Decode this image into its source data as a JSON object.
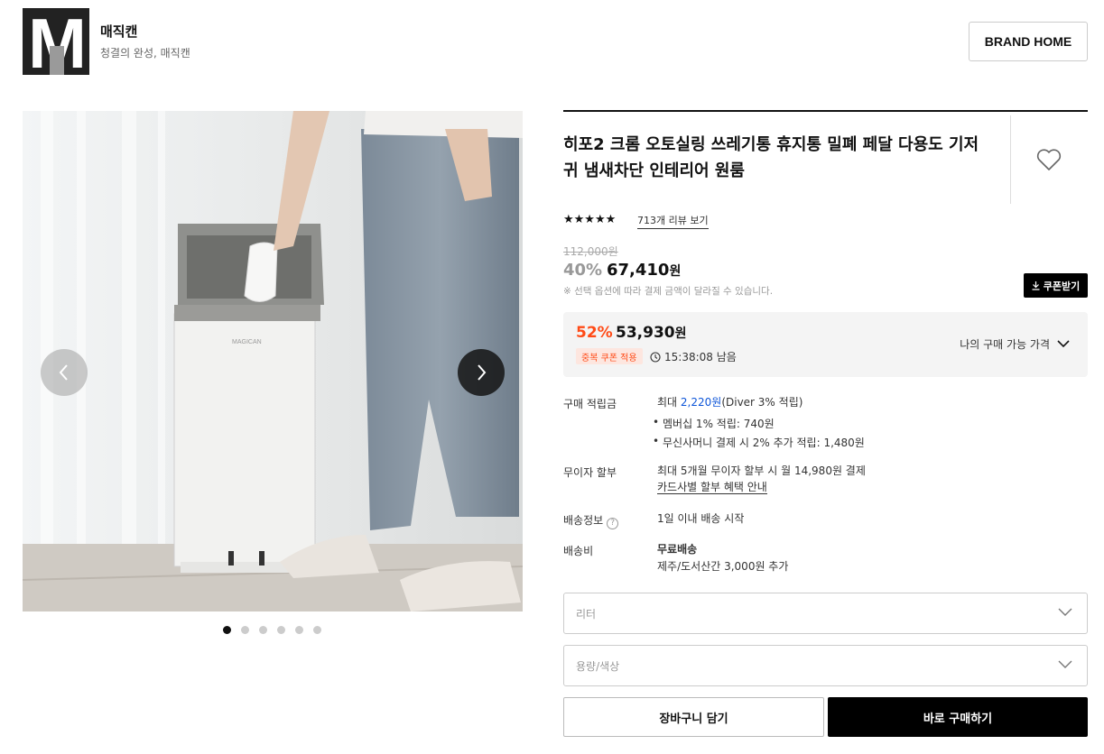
{
  "brand": {
    "logo_letter": "M",
    "name": "매직캔",
    "slogan": "청결의 완성, 매직캔",
    "home_button": "BRAND HOME"
  },
  "gallery": {
    "image_brand_text": "MAGICAN",
    "slide_count": 6,
    "active_slide": 1
  },
  "product": {
    "title": "히포2 크롬 오토실링 쓰레기통 휴지통 밀폐 페달 다용도 기저귀 냄새차단 인테리어 원룸",
    "rating_stars": "★★★★★",
    "review_link": "713개 리뷰 보기",
    "original_price": "112,000원",
    "discount_rate": "40%",
    "price": "67,410",
    "price_unit": "원",
    "notice": "※ 선택 옵션에 따라 결제 금액이 달라질 수 있습니다.",
    "coupon_button": "쿠폰받기"
  },
  "my_price": {
    "rate": "52%",
    "price": "53,930",
    "unit": "원",
    "badge": "중복 쿠폰 적용",
    "timer": "15:38:08 남음",
    "label": "나의 구매 가능 가격"
  },
  "info": {
    "points_label": "구매 적립금",
    "points_prefix": "최대 ",
    "points_amount": "2,220원",
    "points_suffix": "(Diver 3% 적립)",
    "points_bullet_1": "멤버십 1% 적립: 740원",
    "points_bullet_2": "무신사머니 결제 시 2% 추가 적립: 1,480원",
    "installment_label": "무이자 할부",
    "installment_value": "최대 5개월 무이자 할부 시 월 14,980원 결제",
    "installment_link": "카드사별 할부 혜택 안내",
    "shipping_label": "배송정보",
    "shipping_help": "?",
    "shipping_value": "1일 이내 배송 시작",
    "fee_label": "배송비",
    "fee_value": "무료배송",
    "fee_extra": "제주/도서산간 3,000원 추가"
  },
  "options": {
    "select_1_placeholder": "리터",
    "select_2_placeholder": "용량/색상"
  },
  "actions": {
    "cart": "장바구니 담기",
    "buy": "바로 구매하기"
  },
  "colors": {
    "accent": "#ff4b17",
    "points_blue": "#0d55d8",
    "primary_button": "#000000"
  }
}
